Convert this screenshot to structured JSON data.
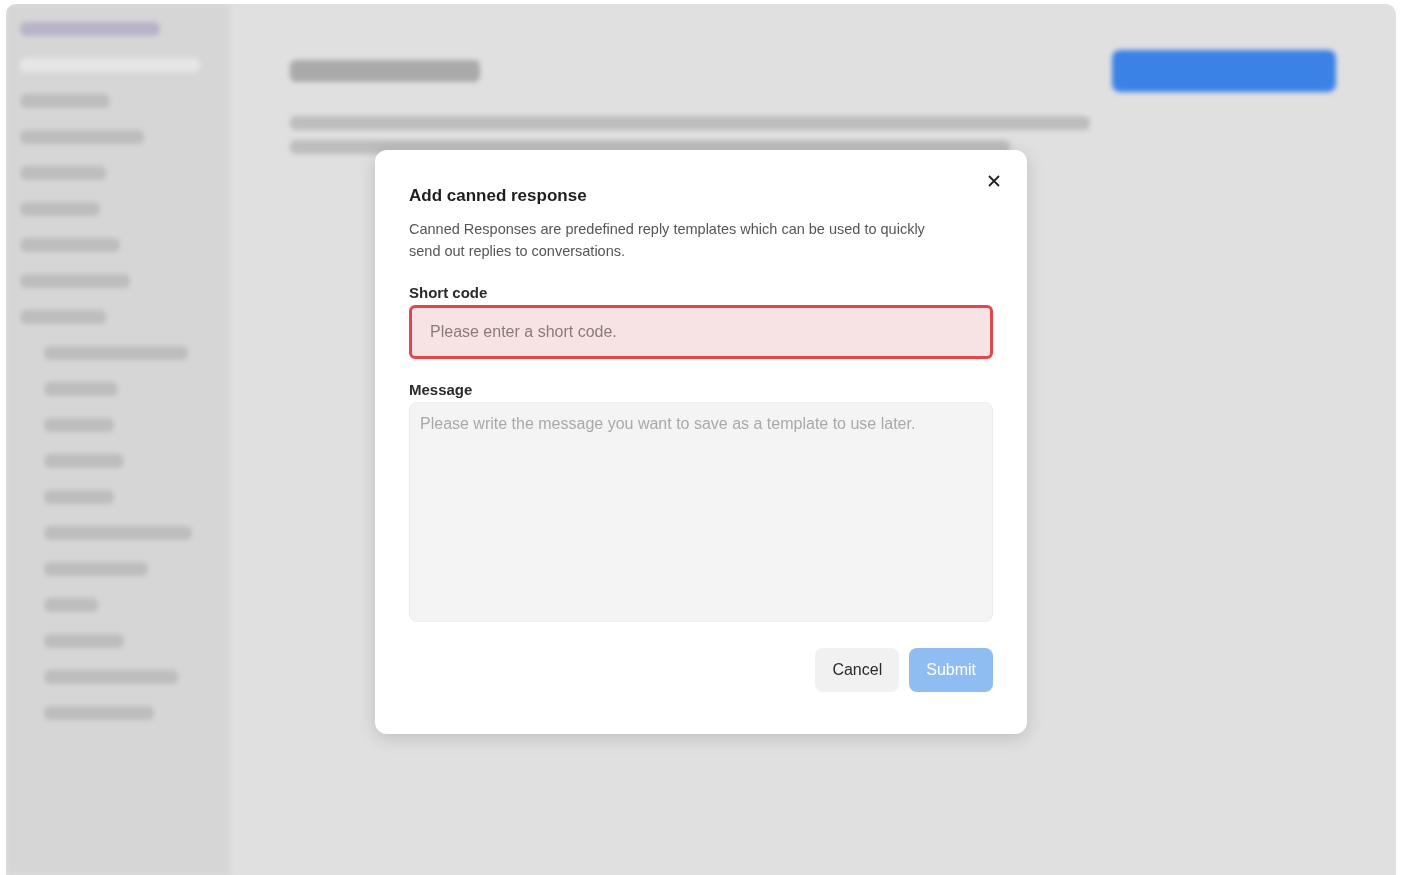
{
  "dialog": {
    "title": "Add canned response",
    "description": "Canned Responses are predefined reply templates which can be used to quickly send out replies to conversations.",
    "fields": [
      {
        "kind": "input",
        "label": "Short code",
        "placeholder": "Please enter a short code.",
        "error": true
      },
      {
        "kind": "textarea",
        "label": "Message",
        "placeholder": "Please write the message you want to save as a template to use later.",
        "error": false
      }
    ],
    "buttons": [
      {
        "label": "Cancel",
        "kind": "secondary",
        "disabled": false
      },
      {
        "label": "Submit",
        "kind": "primary",
        "disabled": true
      }
    ]
  }
}
